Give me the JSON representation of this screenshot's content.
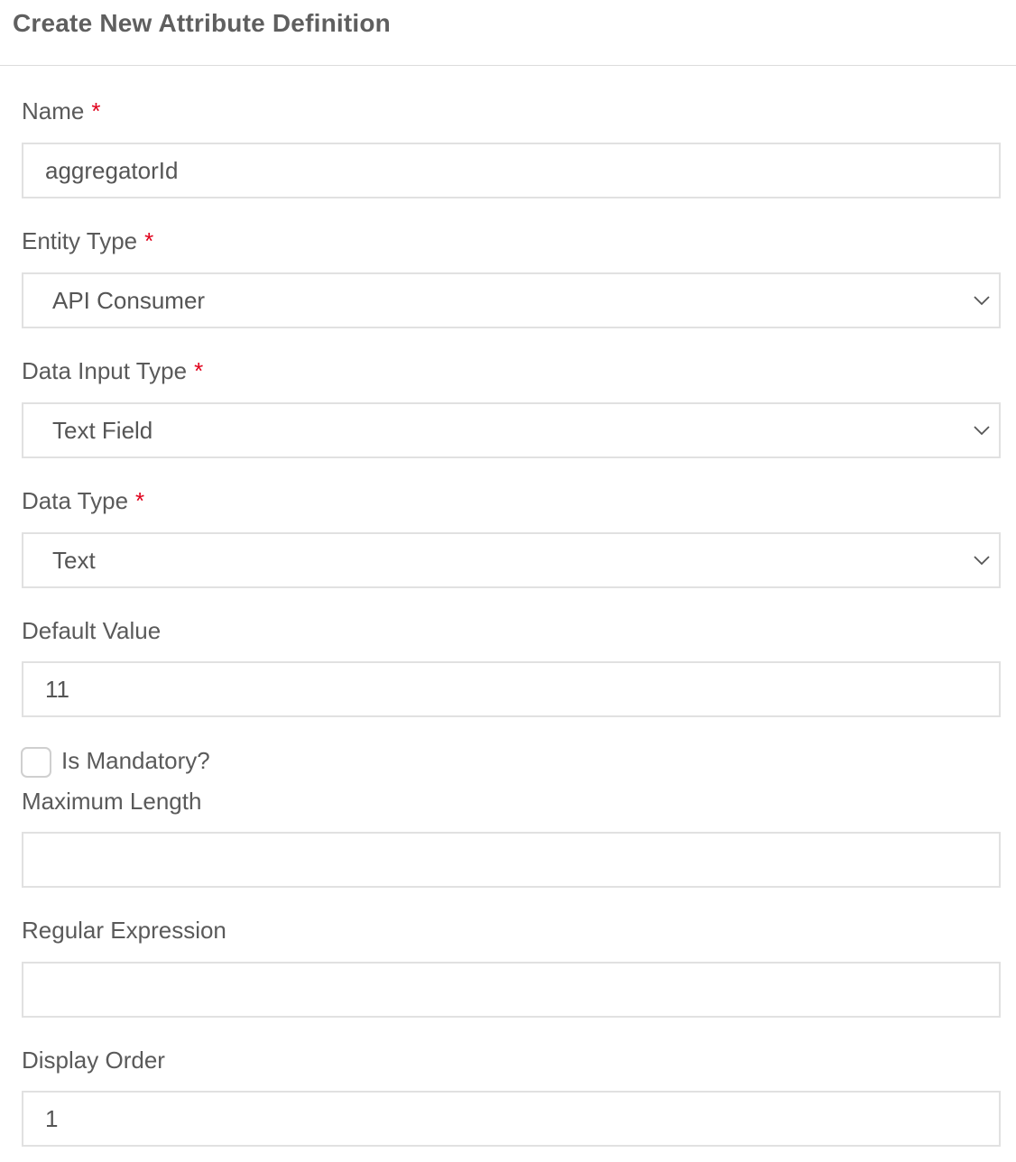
{
  "header": {
    "title": "Create New Attribute Definition"
  },
  "form": {
    "name": {
      "label": "Name",
      "required_mark": "*",
      "value": "aggregatorId"
    },
    "entity_type": {
      "label": "Entity Type",
      "required_mark": "*",
      "selected": "API Consumer"
    },
    "data_input_type": {
      "label": "Data Input Type",
      "required_mark": "*",
      "selected": "Text Field"
    },
    "data_type": {
      "label": "Data Type",
      "required_mark": "*",
      "selected": "Text"
    },
    "default_value": {
      "label": "Default Value",
      "value": "11"
    },
    "is_mandatory": {
      "label": "Is Mandatory?",
      "checked": false
    },
    "maximum_length": {
      "label": "Maximum Length",
      "value": ""
    },
    "regular_expression": {
      "label": "Regular Expression",
      "value": ""
    },
    "display_order": {
      "label": "Display Order",
      "value": "1"
    }
  },
  "icons": {
    "select_arrow": "chevron-down-icon"
  },
  "colors": {
    "required": "#e0001b",
    "border": "#e1e1e1",
    "text": "#5a5a5a"
  }
}
